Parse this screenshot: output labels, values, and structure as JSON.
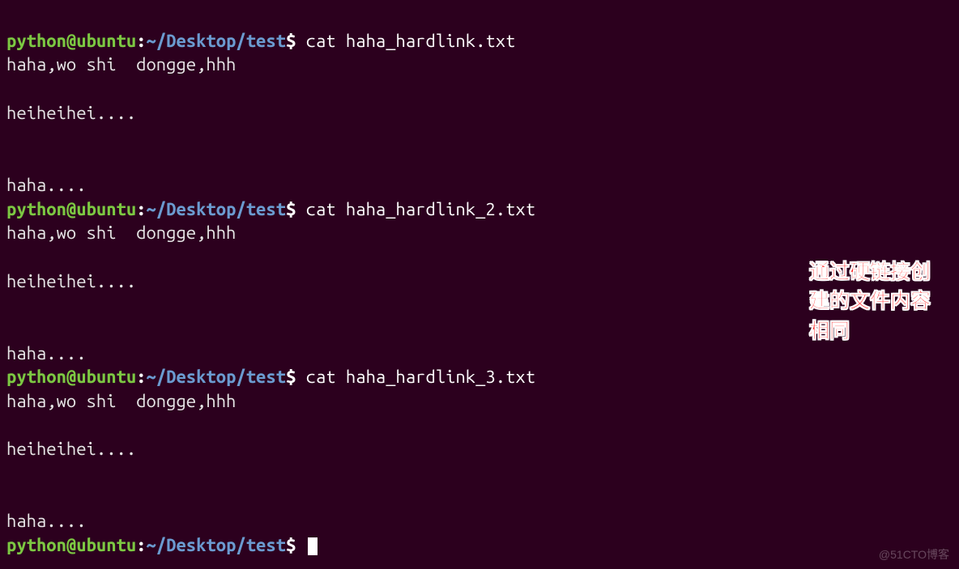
{
  "prompt": {
    "user": "python",
    "at": "@",
    "host": "ubuntu",
    "colon": ":",
    "tilde": "~",
    "path": "/Desktop/test",
    "dollar": "$"
  },
  "blocks": [
    {
      "command": "cat haha_hardlink.txt",
      "output": [
        "haha,wo shi  dongge,hhh",
        "",
        "heiheihei....",
        "",
        "",
        "haha...."
      ]
    },
    {
      "command": "cat haha_hardlink_2.txt",
      "output": [
        "haha,wo shi  dongge,hhh",
        "",
        "heiheihei....",
        "",
        "",
        "haha...."
      ]
    },
    {
      "command": "cat haha_hardlink_3.txt",
      "output": [
        "haha,wo shi  dongge,hhh",
        "",
        "heiheihei....",
        "",
        "",
        "haha...."
      ]
    }
  ],
  "final_prompt": true,
  "annotation": {
    "line1": "通过硬链接创",
    "line2": "建的文件内容",
    "line3": "相同"
  },
  "watermark": "@51CTO博客"
}
